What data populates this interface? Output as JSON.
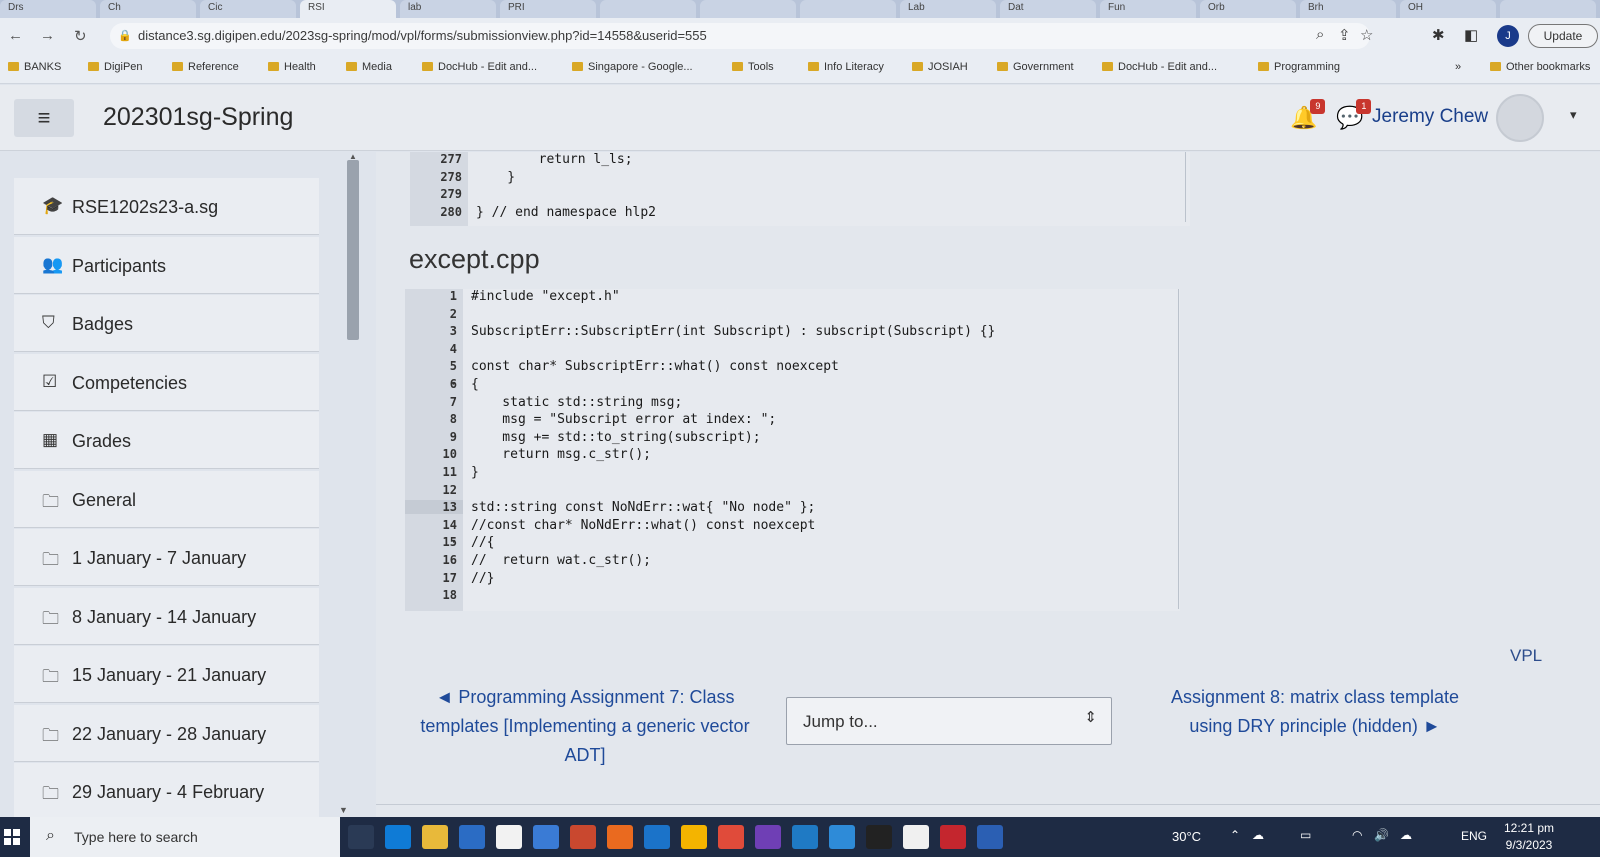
{
  "browser": {
    "tabs": [
      "Drs",
      "Ch",
      "Cic",
      "RSI",
      "lab",
      "PRI",
      "",
      "",
      "",
      "Lab",
      "Dat",
      "Fun",
      "Orb",
      "Brh",
      "OH",
      ""
    ],
    "url": "distance3.sg.digipen.edu/2023sg-spring/mod/vpl/forms/submissionview.php?id=14558&userid=555",
    "profile_initial": "J",
    "update_label": "Update",
    "bookmarks": [
      "BANKS",
      "DigiPen",
      "Reference",
      "Health",
      "Media",
      "DocHub - Edit and...",
      "Singapore - Google...",
      "Tools",
      "Info Literacy",
      "JOSIAH",
      "Government",
      "DocHub - Edit and...",
      "Programming"
    ],
    "more_bookmarks": "»",
    "other_bookmarks": "Other bookmarks"
  },
  "navbar": {
    "site_name": "202301sg-Spring",
    "notification_count": "9",
    "message_count": "1",
    "user_name": "Jeremy Chew"
  },
  "drawer": {
    "items": [
      {
        "icon": "graduation-cap-icon",
        "label": "RSE1202s23-a.sg"
      },
      {
        "icon": "users-icon",
        "label": "Participants"
      },
      {
        "icon": "shield-icon",
        "label": "Badges"
      },
      {
        "icon": "check-square-icon",
        "label": "Competencies"
      },
      {
        "icon": "table-icon",
        "label": "Grades"
      },
      {
        "icon": "folder-icon",
        "label": "General"
      },
      {
        "icon": "folder-icon",
        "label": "1 January - 7 January"
      },
      {
        "icon": "folder-icon",
        "label": "8 January - 14 January"
      },
      {
        "icon": "folder-icon",
        "label": "15 January - 21 January"
      },
      {
        "icon": "folder-icon",
        "label": "22 January - 28 January"
      },
      {
        "icon": "folder-icon",
        "label": "29 January - 4 February"
      }
    ]
  },
  "prev_code": {
    "lines": [
      {
        "num": "277",
        "src": "        return l_ls;"
      },
      {
        "num": "278",
        "src": "    }"
      },
      {
        "num": "279",
        "src": ""
      },
      {
        "num": "280",
        "src": "} // end namespace hlp2"
      }
    ]
  },
  "file": {
    "title": "except.cpp",
    "lines": [
      {
        "num": "1",
        "src": "#include \"except.h\""
      },
      {
        "num": "2",
        "src": ""
      },
      {
        "num": "3",
        "src": "SubscriptErr::SubscriptErr(int Subscript) : subscript(Subscript) {}"
      },
      {
        "num": "4",
        "src": ""
      },
      {
        "num": "5",
        "src": "const char* SubscriptErr::what() const noexcept"
      },
      {
        "num": "6",
        "src": "{",
        "fold": "▾"
      },
      {
        "num": "7",
        "src": "    static std::string msg;"
      },
      {
        "num": "8",
        "src": "    msg = \"Subscript error at index: \";"
      },
      {
        "num": "9",
        "src": "    msg += std::to_string(subscript);"
      },
      {
        "num": "10",
        "src": "    return msg.c_str();"
      },
      {
        "num": "11",
        "src": "}"
      },
      {
        "num": "12",
        "src": ""
      },
      {
        "num": "13",
        "src": "std::string const NoNdErr::wat{ \"No node\" };",
        "highlight": true
      },
      {
        "num": "14",
        "src": "//const char* NoNdErr::what() const noexcept"
      },
      {
        "num": "15",
        "src": "//{",
        "fold": "▾"
      },
      {
        "num": "16",
        "src": "//  return wat.c_str();"
      },
      {
        "num": "17",
        "src": "//}"
      },
      {
        "num": "18",
        "src": ""
      }
    ]
  },
  "footer": {
    "vpl_label": "VPL",
    "prev_link": "◄ Programming Assignment 7: Class templates [Implementing a generic vector ADT]",
    "jump_label": "Jump to...",
    "next_link": "Assignment 8: matrix class template using DRY principle (hidden) ►"
  },
  "taskbar": {
    "search_placeholder": "Type here to search",
    "apps": [
      "Task View",
      "Edge",
      "File Explorer",
      "Store",
      "Amazon",
      "App",
      "PowerPoint",
      "Firefox",
      "Mail",
      "Drive",
      "Chrome",
      "Visual Studio",
      "VS Code",
      "Photos",
      "Terminal",
      "Typora",
      "McAfee",
      "Word"
    ],
    "temperature": "30°C",
    "language": "ENG",
    "time": "12:21 pm",
    "date": "9/3/2023"
  },
  "colors": {
    "link": "#1f4a99",
    "badge": "#c8362e",
    "taskbar": "#1e2b44"
  }
}
